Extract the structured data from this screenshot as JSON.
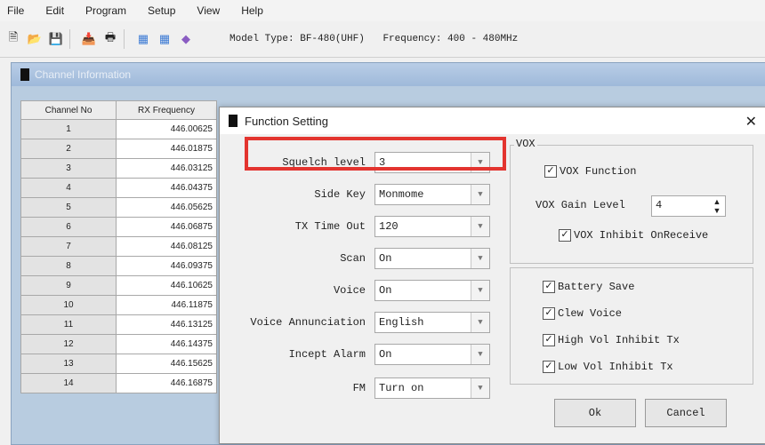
{
  "menu": [
    "File",
    "Edit",
    "Program",
    "Setup",
    "View",
    "Help"
  ],
  "toolbar_icons": [
    "new-file-icon",
    "open-folder-icon",
    "save-icon",
    "read-radio-icon",
    "print-icon",
    "write-radio-icon",
    "radio-settings-icon",
    "help-book-icon"
  ],
  "toolbar_info": {
    "model": "Model Type: BF-480(UHF)",
    "frequency": "Frequency: 400 - 480MHz"
  },
  "channel_window": {
    "title": "Channel Information",
    "columns": [
      "Channel No",
      "RX Frequency"
    ],
    "rows": [
      {
        "ch": "1",
        "rx": "446.00625"
      },
      {
        "ch": "2",
        "rx": "446.01875"
      },
      {
        "ch": "3",
        "rx": "446.03125"
      },
      {
        "ch": "4",
        "rx": "446.04375"
      },
      {
        "ch": "5",
        "rx": "446.05625"
      },
      {
        "ch": "6",
        "rx": "446.06875"
      },
      {
        "ch": "7",
        "rx": "446.08125"
      },
      {
        "ch": "8",
        "rx": "446.09375"
      },
      {
        "ch": "9",
        "rx": "446.10625"
      },
      {
        "ch": "10",
        "rx": "446.11875"
      },
      {
        "ch": "11",
        "rx": "446.13125"
      },
      {
        "ch": "12",
        "rx": "446.14375"
      },
      {
        "ch": "13",
        "rx": "446.15625"
      },
      {
        "ch": "14",
        "rx": "446.16875"
      }
    ]
  },
  "dialog": {
    "title": "Function Setting",
    "fields": [
      {
        "label": "Squelch level",
        "value": "3"
      },
      {
        "label": "Side Key",
        "value": "Monmome"
      },
      {
        "label": "TX Time Out",
        "value": "120"
      },
      {
        "label": "Scan",
        "value": "On"
      },
      {
        "label": "Voice",
        "value": "On"
      },
      {
        "label": "Voice Annunciation",
        "value": "English"
      },
      {
        "label": "Incept Alarm",
        "value": "On"
      },
      {
        "label": "FM",
        "value": "Turn on"
      }
    ],
    "vox": {
      "group_label": "VOX",
      "function": "VOX Function",
      "gain_label": "VOX Gain Level",
      "gain_value": "4",
      "inhibit": "VOX Inhibit OnReceive"
    },
    "options": [
      "Battery Save",
      "Clew Voice",
      "High Vol Inhibit Tx",
      "Low Vol Inhibit Tx"
    ],
    "ok": "Ok",
    "cancel": "Cancel"
  }
}
